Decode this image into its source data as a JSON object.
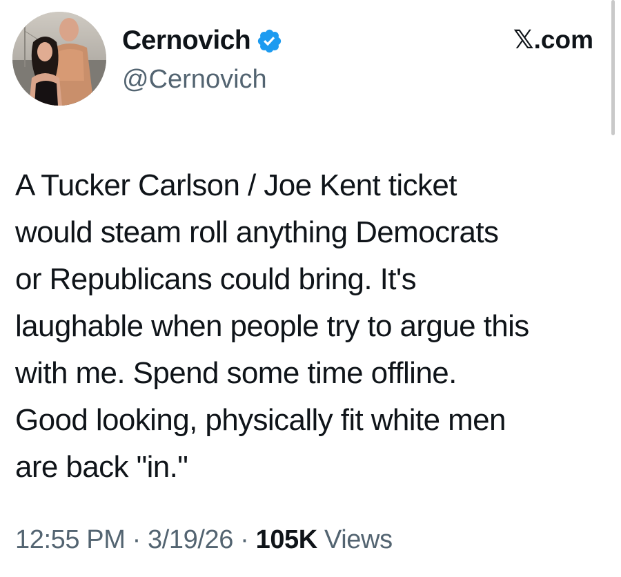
{
  "author": {
    "display_name": "Cernovich",
    "handle": "@Cernovich",
    "verified": true
  },
  "site_label": "𝕏.com",
  "tweet": {
    "lines": [
      "A Tucker Carlson / Joe Kent ticket",
      "would steam roll anything Democrats",
      "or Republicans could bring. It's",
      "laughable when people try to argue this",
      "with me. Spend some time offline.",
      "Good looking, physically fit white men",
      "are back \"in.\""
    ]
  },
  "meta": {
    "time": "12:55 PM",
    "separator": " · ",
    "date": "3/19/26",
    "views_count": "105K",
    "views_label": " Views"
  },
  "colors": {
    "text_primary": "#0f1419",
    "text_secondary": "#536471",
    "verified_badge": "#1d9bf0"
  },
  "icons": {
    "verified": "verified-badge-icon"
  }
}
